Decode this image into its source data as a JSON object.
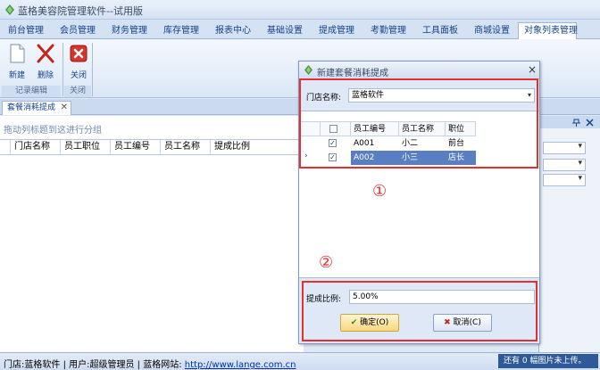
{
  "app": {
    "title": "蓝格美容院管理软件--试用版"
  },
  "menu": {
    "tabs": [
      {
        "label": "前台管理"
      },
      {
        "label": "会员管理"
      },
      {
        "label": "财务管理"
      },
      {
        "label": "库存管理"
      },
      {
        "label": "报表中心"
      },
      {
        "label": "基础设置"
      },
      {
        "label": "提成管理"
      },
      {
        "label": "考勤管理"
      },
      {
        "label": "工具面板"
      },
      {
        "label": "商城设置"
      },
      {
        "label": "对象列表管理"
      }
    ]
  },
  "ribbon": {
    "new_label": "新建",
    "delete_label": "删除",
    "close_label": "关闭",
    "group_record_edit": "记录编辑",
    "group_close": "关闭"
  },
  "doc_tab": {
    "label": "套餐消耗提成",
    "close": "✕"
  },
  "main": {
    "group_hint": "拖动列标题到这进行分组",
    "columns": [
      "门店名称",
      "员工职位",
      "员工编号",
      "员工名称",
      "提成比例"
    ]
  },
  "dialog": {
    "title": "新建套餐消耗提成",
    "close": "×",
    "store_label": "门店名称:",
    "store_value": "蓝格软件",
    "columns": [
      "员工编号",
      "员工名称",
      "职位"
    ],
    "rows": [
      {
        "id": "A001",
        "name": "小二",
        "position": "前台",
        "checked": true
      },
      {
        "id": "A002",
        "name": "小三",
        "position": "店长",
        "checked": true
      }
    ],
    "pct_label": "提成比例:",
    "pct_value": "5.00%",
    "ok_label": "确定(O)",
    "cancel_label": "取消(C)",
    "annotation_1": "①",
    "annotation_2": "②"
  },
  "status": {
    "store_prefix": "门店:",
    "store": "蓝格软件",
    "user_prefix": "| 用户:",
    "user": "超级管理员",
    "site_prefix": "| 蓝格网站:",
    "site": "http://www.lange.com.cn",
    "right": "还有 0 幅图片未上传。"
  },
  "colors": {
    "accent": "#15428b",
    "selection": "#5a7ec2",
    "annotation": "#e53030"
  }
}
